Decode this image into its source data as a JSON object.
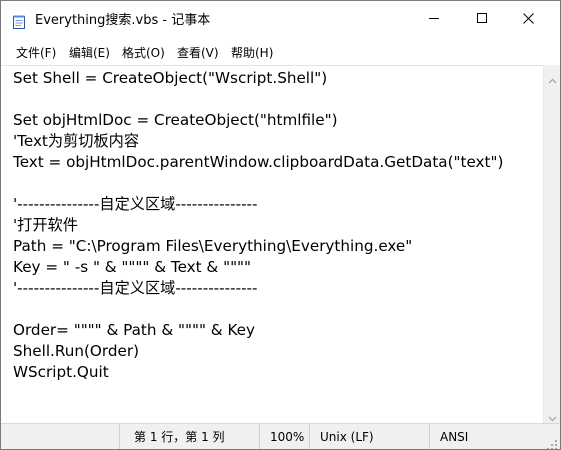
{
  "window": {
    "title": "Everything搜索.vbs - 记事本"
  },
  "icons": {
    "app": "notepad-icon",
    "minimize": "minimize-icon",
    "maximize": "maximize-icon",
    "close": "close-icon",
    "scroll_up": "chevron-up-icon",
    "scroll_down": "chevron-down-icon",
    "resize": "resize-grip-icon"
  },
  "menu": [
    {
      "label": "文件(F)"
    },
    {
      "label": "编辑(E)"
    },
    {
      "label": "格式(O)"
    },
    {
      "label": "查看(V)"
    },
    {
      "label": "帮助(H)"
    }
  ],
  "editor": {
    "lines": [
      "Set Shell = CreateObject(\"Wscript.Shell\")",
      "",
      "Set objHtmlDoc = CreateObject(\"htmlfile\")",
      "'Text为剪切板内容",
      "Text = objHtmlDoc.parentWindow.clipboardData.GetData(\"text\")",
      "",
      "'---------------自定义区域---------------",
      "'打开软件",
      "Path = \"C:\\Program Files\\Everything\\Everything.exe\"",
      "Key = \" -s \" & \"\"\"\" & Text & \"\"\"\"",
      "'---------------自定义区域---------------",
      "",
      "Order= \"\"\"\" & Path & \"\"\"\" & Key",
      "Shell.Run(Order)",
      "WScript.Quit"
    ]
  },
  "status": {
    "position": "第 1 行，第 1 列",
    "zoom": "100%",
    "line_ending": "Unix (LF)",
    "encoding": "ANSI"
  },
  "colors": {
    "statusbar_bg": "#f0f0f0",
    "window_border": "#7a7a7a"
  }
}
